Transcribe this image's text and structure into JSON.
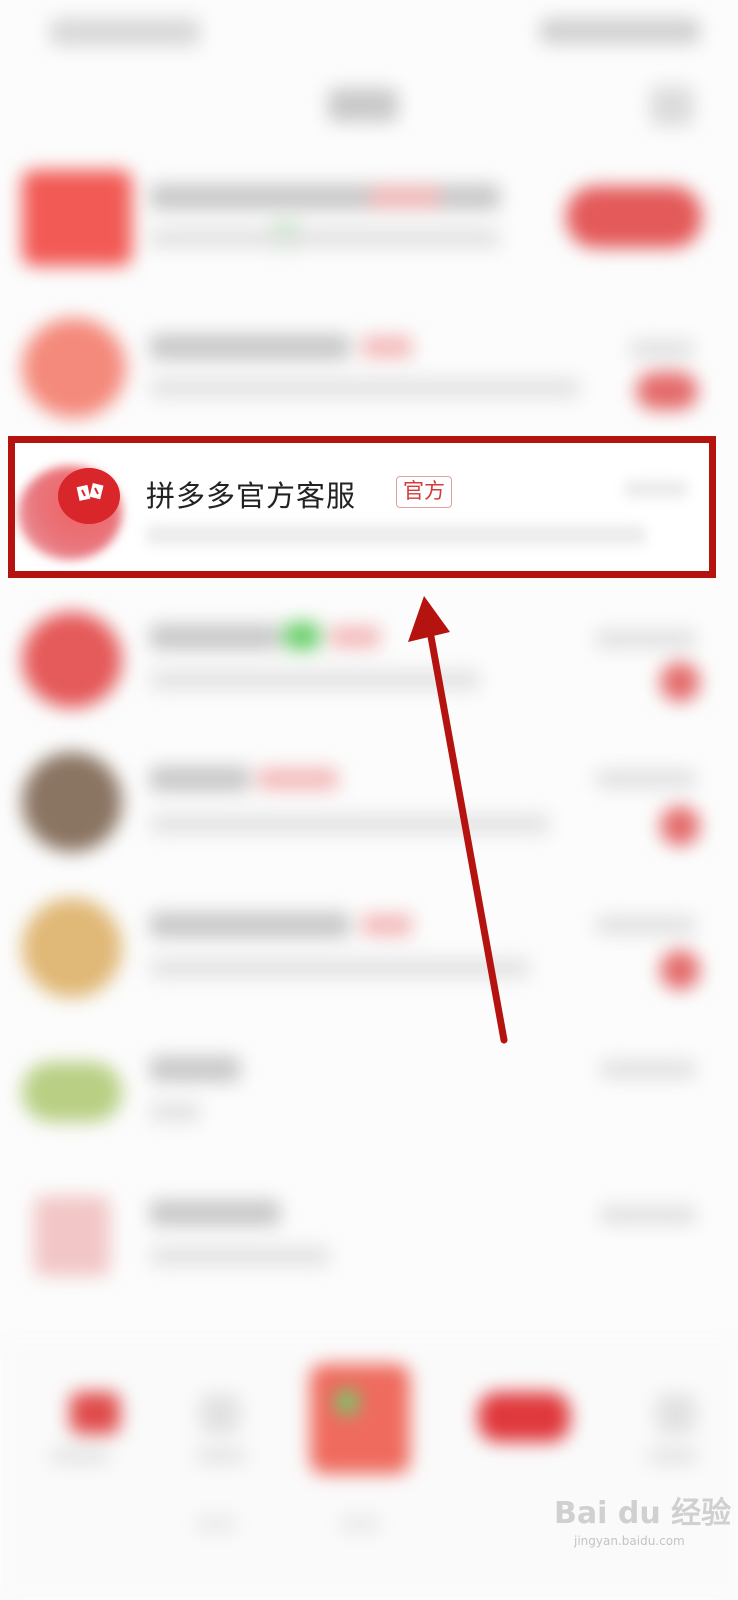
{
  "highlighted_item": {
    "name": "拼多多官方客服",
    "badge": "官方"
  },
  "watermark": {
    "brand": "Bai du 经验",
    "url": "jingyan.baidu.com"
  },
  "colors": {
    "highlight_border": "#b5130f",
    "arrow": "#b5130f",
    "badge_text": "#d33a3a",
    "brand_red": "#d8262b"
  },
  "icons": {
    "avatar": "pinduoduo-logo-icon",
    "annotation": "arrow-up-icon"
  }
}
